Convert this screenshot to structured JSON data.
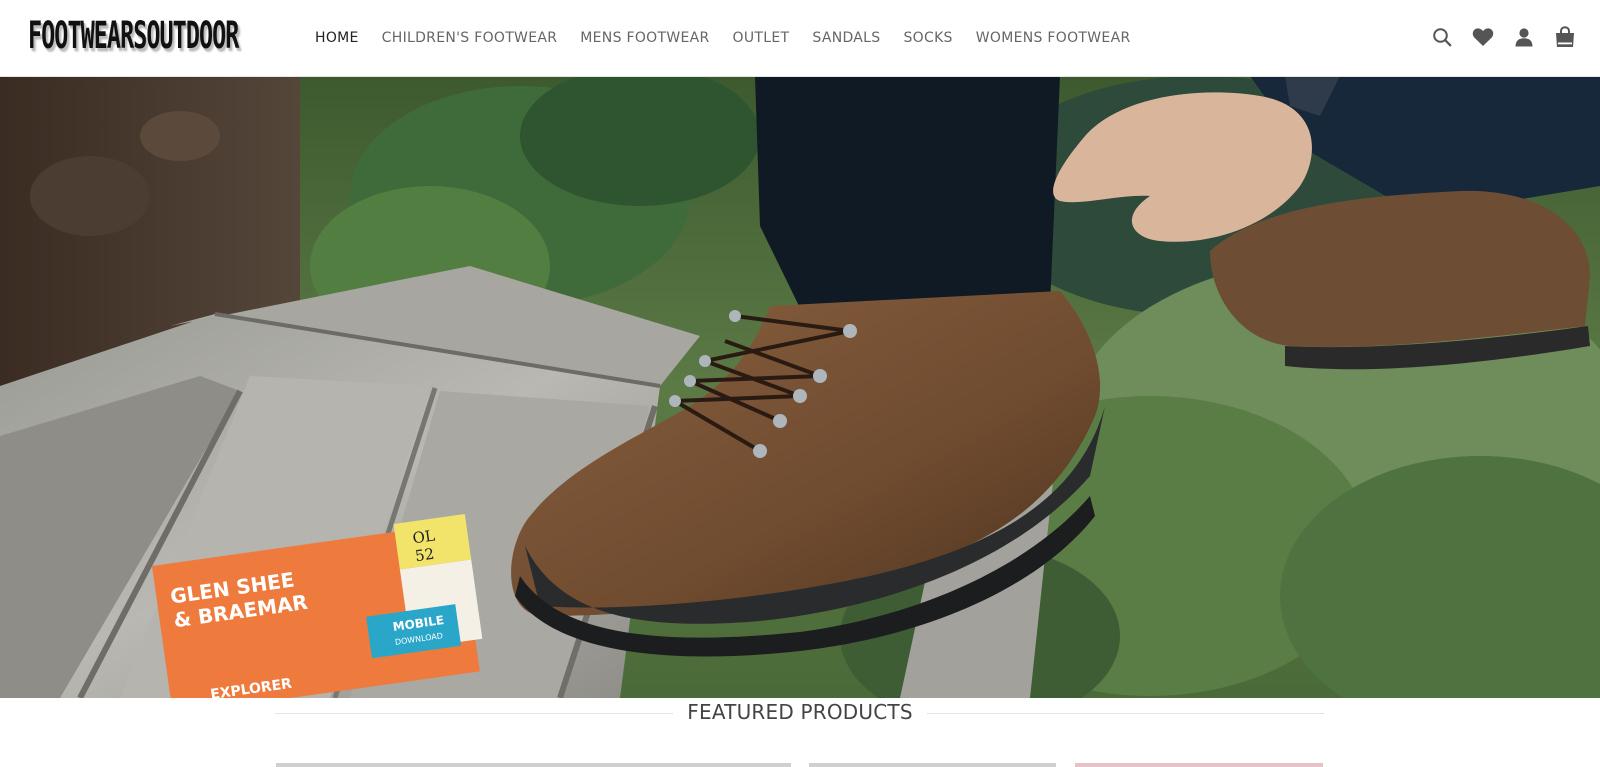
{
  "site": {
    "logo_text": "FOOTWEARSOUTDOOR"
  },
  "nav": {
    "items": [
      {
        "label": "HOME",
        "active": true
      },
      {
        "label": "CHILDREN'S FOOTWEAR",
        "active": false
      },
      {
        "label": "MENS FOOTWEAR",
        "active": false
      },
      {
        "label": "OUTLET",
        "active": false
      },
      {
        "label": "SANDALS",
        "active": false
      },
      {
        "label": "SOCKS",
        "active": false
      },
      {
        "label": "WOMENS FOOTWEAR",
        "active": false
      }
    ]
  },
  "header_icons": [
    "search-icon",
    "heart-icon",
    "user-icon",
    "cart-icon"
  ],
  "hero": {
    "map_title_line1": "GLEN SHEE",
    "map_title_line2": "& BRAEMAR",
    "map_code_line1": "OL",
    "map_code_line2": "52",
    "map_badge_line1": "MOBILE",
    "map_badge_line2": "DOWNLOAD",
    "map_series": "EXPLORER"
  },
  "featured": {
    "title": "FEATURED PRODUCTS"
  },
  "colors": {
    "text_dark": "#222222",
    "nav_text": "#666666",
    "hero_grass": "#4f6b3a",
    "boot_leather": "#7a5434",
    "map_orange": "#ee7b3d"
  }
}
